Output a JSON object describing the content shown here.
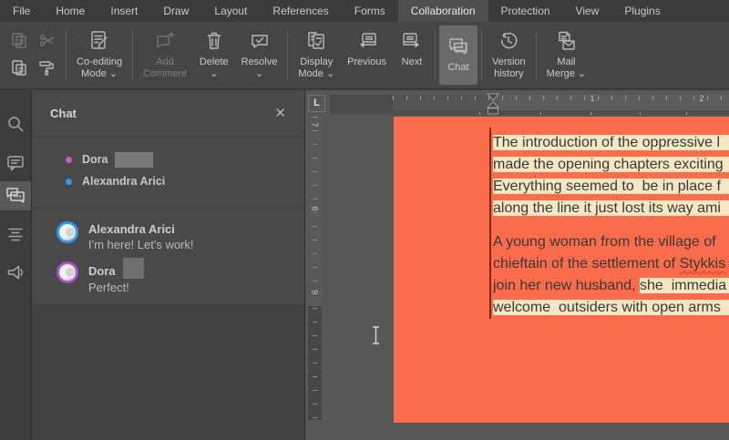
{
  "menu": {
    "tabs": [
      "File",
      "Home",
      "Insert",
      "Draw",
      "Layout",
      "References",
      "Forms",
      "Collaboration",
      "Protection",
      "View",
      "Plugins"
    ],
    "active_tab": "Collaboration"
  },
  "toolbar": {
    "coediting": {
      "line1": "Co-editing",
      "line2": "Mode ⌄"
    },
    "add_comment": {
      "line1": "Add",
      "line2": "Comment"
    },
    "delete": {
      "line1": "Delete",
      "line2": "⌄"
    },
    "resolve": {
      "line1": "Resolve",
      "line2": "⌄"
    },
    "display": {
      "line1": "Display",
      "line2": "Mode ⌄"
    },
    "previous": {
      "line1": "Previous"
    },
    "next": {
      "line1": "Next"
    },
    "chat": {
      "line1": "Chat"
    },
    "version": {
      "line1": "Version",
      "line2": "history"
    },
    "mail": {
      "line1": "Mail",
      "line2": "Merge ⌄"
    }
  },
  "chat": {
    "title": "Chat",
    "close_glyph": "✕",
    "participants": [
      {
        "name": "Dora",
        "redacted": true
      },
      {
        "name": "Alexandra Arici"
      }
    ],
    "messages": [
      {
        "name": "Alexandra Arici",
        "text": "I'm here! Let's work!"
      },
      {
        "name": "Dora",
        "redacted": true,
        "text": "Perfect!"
      }
    ]
  },
  "ruler": {
    "corner": "L",
    "h_numbers": [
      "1",
      "2"
    ],
    "v_numbers": [
      "7",
      "8",
      "9"
    ]
  },
  "doc": {
    "p1": {
      "l1": "The introduction of the oppressive l",
      "l2": "made the opening chapters exciting",
      "l3": "Everything seemed to  be in place f",
      "l4": "along the line it just lost its way ami"
    },
    "p2": {
      "l1": "A young woman from the village of ",
      "l2a": "chieftain of the settlement of ",
      "l2b": "Stykkis",
      "l3a": "join her new husband, ",
      "l3b": "she  immedia",
      "l4": "welcome  outsiders with open arms"
    }
  },
  "colors": {
    "page": "#FA6C4C",
    "highlight": "#F6E7C2",
    "reviewBar": "#7E2713",
    "doraDot": "#CF56CF",
    "alexandraDot": "#2D9BF0",
    "doraRing": "#AB53C8",
    "alexandraRing": "#2D9BF0"
  }
}
